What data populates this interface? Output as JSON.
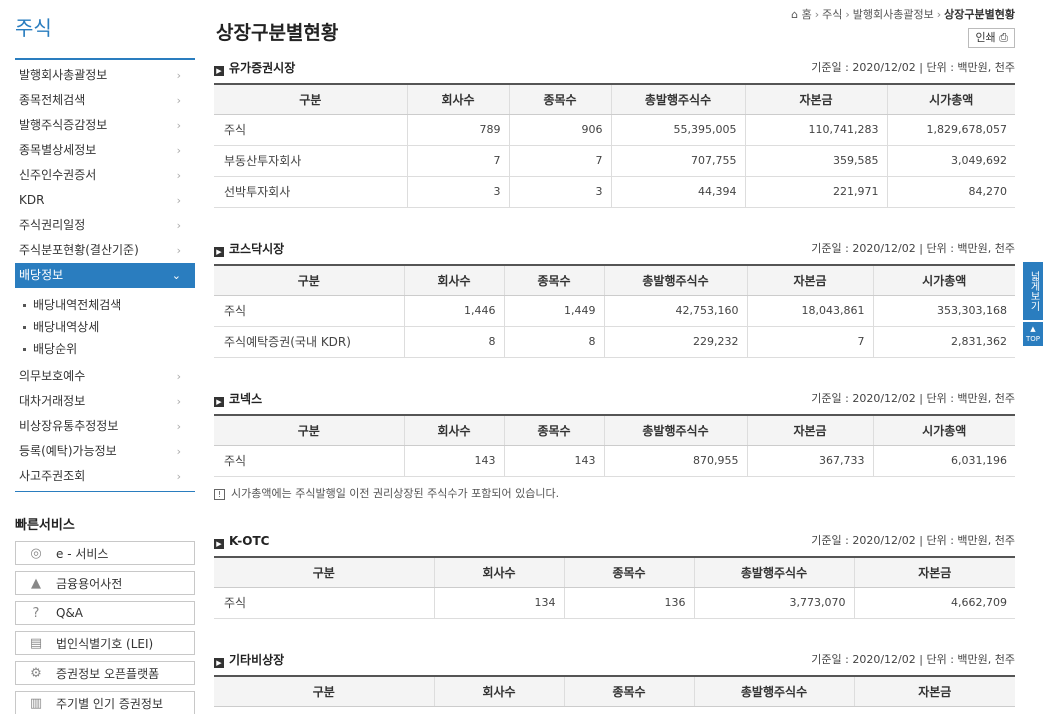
{
  "sidebar": {
    "title": "주식",
    "items": [
      {
        "label": "발행회사총괄정보"
      },
      {
        "label": "종목전체검색"
      },
      {
        "label": "발행주식증감정보"
      },
      {
        "label": "종목별상세정보"
      },
      {
        "label": "신주인수권증서"
      },
      {
        "label": "KDR"
      },
      {
        "label": "주식권리일정"
      },
      {
        "label": "주식분포현황(결산기준)"
      },
      {
        "label": "배당정보"
      },
      {
        "label": "의무보호예수"
      },
      {
        "label": "대차거래정보"
      },
      {
        "label": "비상장유통추정정보"
      },
      {
        "label": "등록(예탁)가능정보"
      },
      {
        "label": "사고주권조회"
      }
    ],
    "sub_items": [
      {
        "label": "배당내역전체검색"
      },
      {
        "label": "배당내역상세"
      },
      {
        "label": "배당순위"
      }
    ]
  },
  "quick": {
    "title": "빠른서비스",
    "buttons": [
      {
        "label": "e - 서비스"
      },
      {
        "label": "금융용어사전"
      },
      {
        "label": "Q&A"
      },
      {
        "label": "법인식별기호 (LEI)"
      },
      {
        "label": "증권정보 오픈플랫폼"
      },
      {
        "label": "주기별 인기 증권정보"
      }
    ]
  },
  "breadcrumb": {
    "home": "홈",
    "c1": "주식",
    "c2": "발행회사총괄정보",
    "current": "상장구분별현황"
  },
  "page_title": "상장구분별현황",
  "print_label": "인쇄",
  "side_tab": {
    "wide_label": "넓게보기",
    "top_label": "TOP"
  },
  "sections": [
    {
      "title": "유가증권시장",
      "meta": "기준일 : 2020/12/02  |  단위 : 백만원, 천주",
      "headers": [
        "구분",
        "회사수",
        "종목수",
        "총발행주식수",
        "자본금",
        "시가총액"
      ],
      "rows": [
        [
          "주식",
          "789",
          "906",
          "55,395,005",
          "110,741,283",
          "1,829,678,057"
        ],
        [
          "부동산투자회사",
          "7",
          "7",
          "707,755",
          "359,585",
          "3,049,692"
        ],
        [
          "선박투자회사",
          "3",
          "3",
          "44,394",
          "221,971",
          "84,270"
        ]
      ]
    },
    {
      "title": "코스닥시장",
      "meta": "기준일 : 2020/12/02  |  단위 : 백만원, 천주",
      "headers": [
        "구분",
        "회사수",
        "종목수",
        "총발행주식수",
        "자본금",
        "시가총액"
      ],
      "rows": [
        [
          "주식",
          "1,446",
          "1,449",
          "42,753,160",
          "18,043,861",
          "353,303,168"
        ],
        [
          "주식예탁증권(국내 KDR)",
          "8",
          "8",
          "229,232",
          "7",
          "2,831,362"
        ]
      ]
    },
    {
      "title": "코넥스",
      "meta": "기준일 : 2020/12/02  |  단위 : 백만원, 천주",
      "headers": [
        "구분",
        "회사수",
        "종목수",
        "총발행주식수",
        "자본금",
        "시가총액"
      ],
      "rows": [
        [
          "주식",
          "143",
          "143",
          "870,955",
          "367,733",
          "6,031,196"
        ]
      ],
      "note": "시가총액에는 주식발행일 이전 권리상장된 주식수가 포함되어 있습니다."
    },
    {
      "title": "K-OTC",
      "meta": "기준일 : 2020/12/02  |  단위 : 백만원, 천주",
      "headers": [
        "구분",
        "회사수",
        "종목수",
        "총발행주식수",
        "자본금"
      ],
      "rows": [
        [
          "주식",
          "134",
          "136",
          "3,773,070",
          "4,662,709"
        ]
      ]
    },
    {
      "title": "기타비상장",
      "meta": "기준일 : 2020/12/02  |  단위 : 백만원, 천주",
      "headers": [
        "구분",
        "회사수",
        "종목수",
        "총발행주식수",
        "자본금"
      ],
      "rows": []
    }
  ],
  "colors": {
    "accent": "#2a7dbf"
  }
}
